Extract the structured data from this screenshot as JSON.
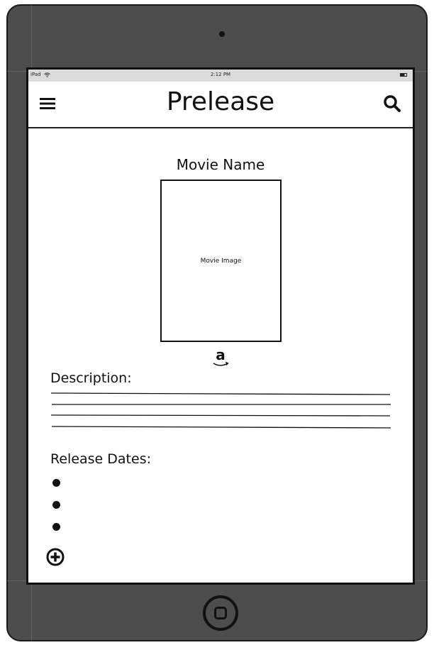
{
  "status_bar": {
    "device": "iPad",
    "wifi_icon": "wifi-icon",
    "time": "2:12 PM",
    "battery_icon": "battery-icon"
  },
  "navbar": {
    "title": "Prelease",
    "menu_icon": "hamburger-menu-icon",
    "search_icon": "search-icon"
  },
  "movie": {
    "name": "Movie Name",
    "image_placeholder": "Movie Image",
    "amazon_icon": "amazon-icon"
  },
  "description": {
    "label": "Description:",
    "line_count": 4
  },
  "release_dates": {
    "label": "Release Dates:",
    "items": [
      "",
      "",
      ""
    ],
    "add_icon": "add-circle-icon"
  },
  "colors": {
    "device_frame": "#4d4d4d",
    "status_bar": "#dcdcdc",
    "ink": "#111111",
    "screen": "#ffffff"
  }
}
